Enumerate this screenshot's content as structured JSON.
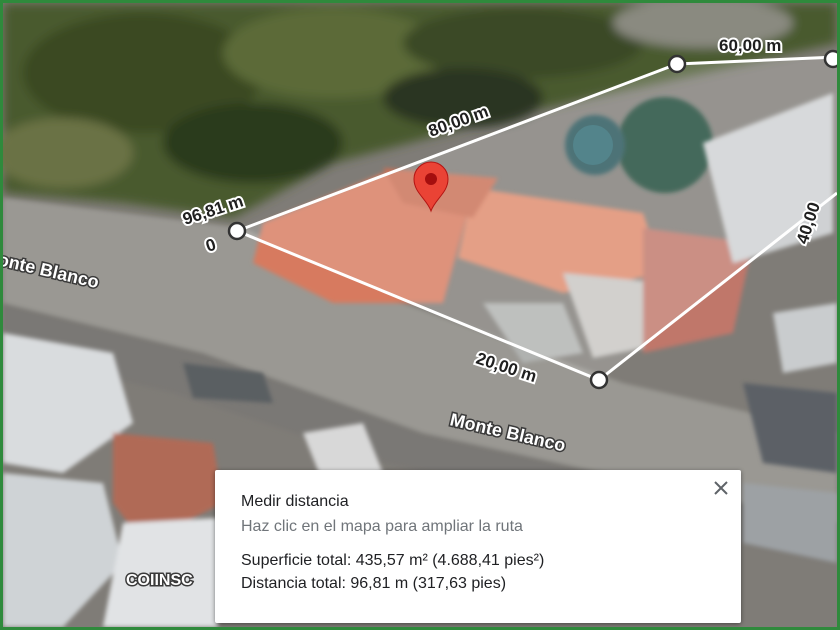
{
  "map": {
    "labels": {
      "street_upper": "onte Blanco",
      "street_lower": "Monte Blanco",
      "place": "COIINSC"
    },
    "distances": {
      "seg1": "96,81 m",
      "seg1_sub": "0",
      "seg2": "80,00 m",
      "seg3": "60,00 m",
      "seg4": "40,00",
      "seg5": "20,00 m"
    },
    "colors": {
      "line": "#ffffff",
      "pin": "#ea4335",
      "frame": "#2f8a3c"
    },
    "icons": {
      "pin": "location-pin-icon",
      "vertex": "vertex-point-icon"
    }
  },
  "panel": {
    "title": "Medir distancia",
    "hint": "Haz clic en el mapa para ampliar la ruta",
    "area": "Superficie total: 435,57 m² (4.688,41 pies²)",
    "distance": "Distancia total: 96,81 m (317,63 pies)",
    "close_icon": "close-icon"
  }
}
